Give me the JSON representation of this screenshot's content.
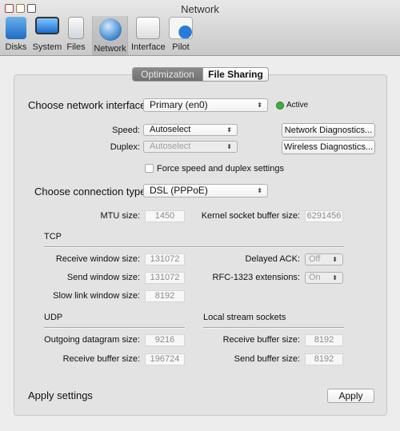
{
  "window": {
    "title": "Network"
  },
  "toolbar": {
    "items": [
      {
        "label": "Disks",
        "icon": "disks-icon"
      },
      {
        "label": "System",
        "icon": "display-icon"
      },
      {
        "label": "Files",
        "icon": "files-icon"
      },
      {
        "label": "Network",
        "icon": "globe-icon",
        "selected": true
      },
      {
        "label": "Interface",
        "icon": "interface-icon"
      },
      {
        "label": "Pilot",
        "icon": "pilot-icon"
      }
    ]
  },
  "tabs": [
    {
      "label": "Optimization",
      "selected": true
    },
    {
      "label": "File Sharing"
    }
  ],
  "interface": {
    "label": "Choose network interface:",
    "value": "Primary (en0)",
    "status": "Active",
    "status_color": "#3cb043"
  },
  "speed": {
    "label": "Speed:",
    "value": "Autoselect"
  },
  "duplex": {
    "label": "Duplex:",
    "value": "Autoselect"
  },
  "buttons": {
    "network_diag": "Network Diagnostics...",
    "wireless_diag": "Wireless Diagnostics...",
    "apply": "Apply"
  },
  "force": {
    "label": "Force speed and duplex settings",
    "checked": false
  },
  "connection": {
    "label": "Choose connection type:",
    "value": "DSL (PPPoE)"
  },
  "mtu": {
    "label": "MTU size:",
    "value": "1450"
  },
  "kernel": {
    "label": "Kernel socket buffer size:",
    "value": "6291456"
  },
  "tcp": {
    "title": "TCP",
    "receive_label": "Receive window size:",
    "receive": "131072",
    "send_label": "Send window size:",
    "send": "131072",
    "slow_label": "Slow link window size:",
    "slow": "8192",
    "delayed_label": "Delayed ACK:",
    "delayed": "Off",
    "rfc_label": "RFC-1323 extensions:",
    "rfc": "On"
  },
  "udp": {
    "title": "UDP",
    "outgoing_label": "Outgoing datagram size:",
    "outgoing": "9216",
    "receive_label": "Receive buffer size:",
    "receive": "196724"
  },
  "local": {
    "title": "Local stream sockets",
    "receive_label": "Receive buffer size:",
    "receive": "8192",
    "send_label": "Send buffer size:",
    "send": "8192"
  },
  "apply_label": "Apply settings"
}
